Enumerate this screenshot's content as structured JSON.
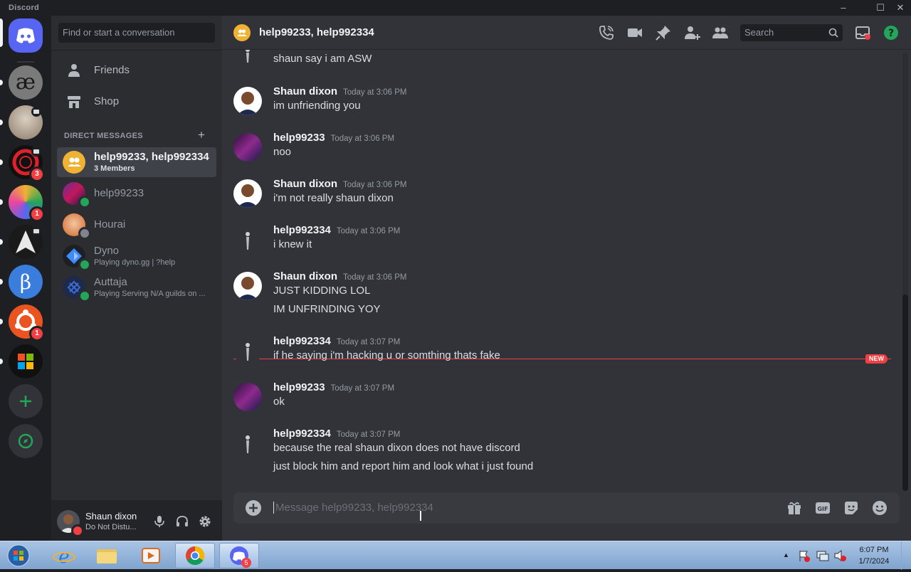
{
  "window": {
    "app_name": "Discord"
  },
  "sidebar": {
    "search_placeholder": "Find or start a conversation",
    "nav": [
      {
        "label": "Friends"
      },
      {
        "label": "Shop"
      }
    ],
    "dm_header": "DIRECT MESSAGES",
    "dms": [
      {
        "name": "help99233, help992334",
        "sub": "3 Members",
        "active": true
      },
      {
        "name": "help99233",
        "sub": ""
      },
      {
        "name": "Hourai",
        "sub": ""
      },
      {
        "name": "Dyno",
        "sub": "Playing dyno.gg | ?help"
      },
      {
        "name": "Auttaja",
        "sub": "Playing Serving N/A guilds on ..."
      }
    ]
  },
  "servers": {
    "badges": [
      "3",
      "1",
      "1"
    ]
  },
  "user": {
    "name": "Shaun dixon",
    "status": "Do Not Distu..."
  },
  "channel": {
    "title": "help99233, help992334"
  },
  "header": {
    "search_placeholder": "Search"
  },
  "messages": [
    {
      "author": "",
      "time": "",
      "lines": [
        "shaun say i am ASW"
      ]
    },
    {
      "author": "Shaun dixon",
      "time": "Today at 3:06 PM",
      "lines": [
        "im unfriending you"
      ]
    },
    {
      "author": "help99233",
      "time": "Today at 3:06 PM",
      "lines": [
        "noo"
      ]
    },
    {
      "author": "Shaun dixon",
      "time": "Today at 3:06 PM",
      "lines": [
        "i'm not really shaun dixon"
      ]
    },
    {
      "author": "help992334",
      "time": "Today at 3:06 PM",
      "lines": [
        "i knew it"
      ]
    },
    {
      "author": "Shaun dixon",
      "time": "Today at 3:06 PM",
      "lines": [
        "JUST KIDDING LOL",
        "IM UNFRINDING YOY"
      ]
    },
    {
      "author": "help992334",
      "time": "Today at 3:07 PM",
      "lines": [
        "if he saying i'm hacking u or somthing thats fake"
      ]
    },
    {
      "author": "help99233",
      "time": "Today at 3:07 PM",
      "lines": [
        "ok"
      ]
    },
    {
      "author": "help992334",
      "time": "Today at 3:07 PM",
      "lines": [
        "because the real shaun dixon does not  have discord",
        "just block him and report him and look what i just found"
      ]
    }
  ],
  "new_divider": "NEW",
  "composer": {
    "placeholder": "Message help99233, help992334"
  },
  "taskbar": {
    "time": "6:07 PM",
    "date": "1/7/2024",
    "discord_badge": "5"
  },
  "colors": {
    "accent": "#5865f2",
    "danger": "#f23f43",
    "online": "#23a55a",
    "dnd": "#f23f43"
  }
}
